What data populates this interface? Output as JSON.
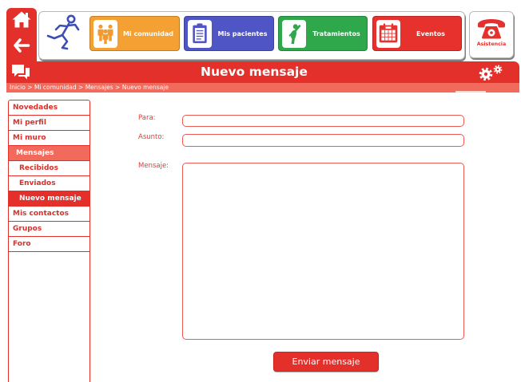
{
  "theme": {
    "primary": "#e4302b",
    "secondary": "#f26a5c",
    "logo_blue": "#3c4eb3"
  },
  "toolbar": {
    "home_icon": "home-icon",
    "back_icon": "back-arrow-icon",
    "logo_icon": "running-figure-icon"
  },
  "nav": [
    {
      "label": "Mi comunidad",
      "icon": "community-icon",
      "color": "#f5a033"
    },
    {
      "label": "Mis pacientes",
      "icon": "clipboard-icon",
      "color": "#4f55c4"
    },
    {
      "label": "Tratamientos",
      "icon": "exercise-icon",
      "color": "#2ea84b"
    },
    {
      "label": "Eventos",
      "icon": "calendar-icon",
      "color": "#e6312d"
    }
  ],
  "assistance": {
    "label": "Asistencia",
    "icon": "telephone-icon"
  },
  "header": {
    "title": "Nuevo mensaje",
    "left_icon": "chat-icon",
    "right_icon": "gears-icon"
  },
  "breadcrumb": {
    "items": [
      "Inicio",
      "Mi comunidad",
      "Mensajes",
      "Nuevo mensaje"
    ],
    "separator": ">"
  },
  "sidebar": {
    "items": [
      {
        "label": "Novedades"
      },
      {
        "label": "Mi perfil"
      },
      {
        "label": "Mi muro"
      },
      {
        "label": "Mensajes",
        "expanded": true,
        "children": [
          {
            "label": "Recibidos"
          },
          {
            "label": "Enviados"
          },
          {
            "label": "Nuevo mensaje",
            "active": true
          }
        ]
      },
      {
        "label": "Mis contactos"
      },
      {
        "label": "Grupos"
      },
      {
        "label": "Foro"
      }
    ]
  },
  "form": {
    "to": {
      "label": "Para:",
      "value": ""
    },
    "subject": {
      "label": "Asunto:",
      "value": ""
    },
    "message": {
      "label": "Mensaje:",
      "value": ""
    },
    "submit_label": "Enviar mensaje"
  }
}
